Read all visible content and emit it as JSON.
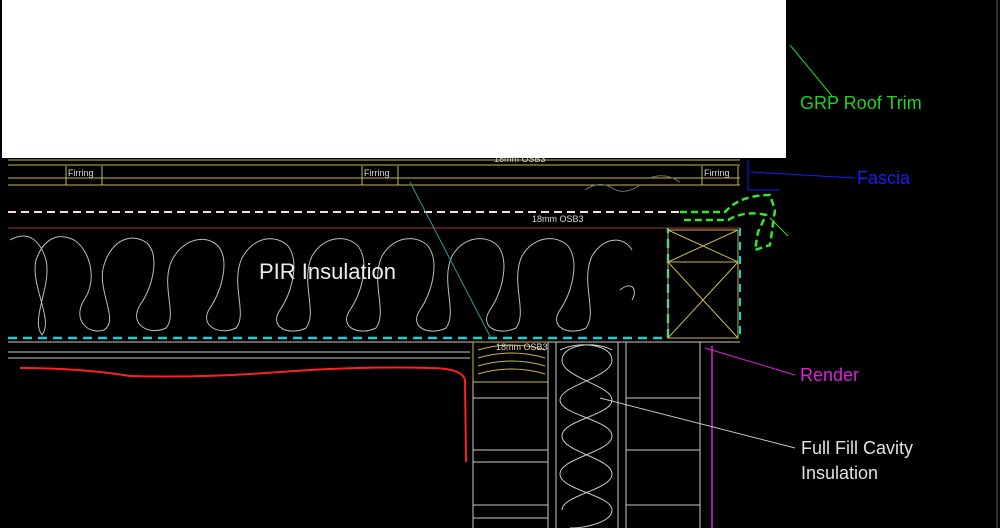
{
  "labels": {
    "pir_insulation": "PIR Insulation",
    "osb_top": "18mm OSB3",
    "osb_mid": "18mm OSB3",
    "osb_low": "18mm OSB3",
    "firring": [
      "Firring",
      "Firring",
      "Firring"
    ]
  },
  "callouts": {
    "grp_trim": "GRP Roof Trim",
    "fascia": "Fascia",
    "render": "Render",
    "cavity_line1": "Full Fill Cavity",
    "cavity_line2": "Insulation"
  },
  "colors": {
    "grp_trim": "#1fd31f",
    "fascia": "#1a1aff",
    "render": "#e020e0",
    "membrane": "#19d0d0",
    "red_line": "#ff2020"
  }
}
